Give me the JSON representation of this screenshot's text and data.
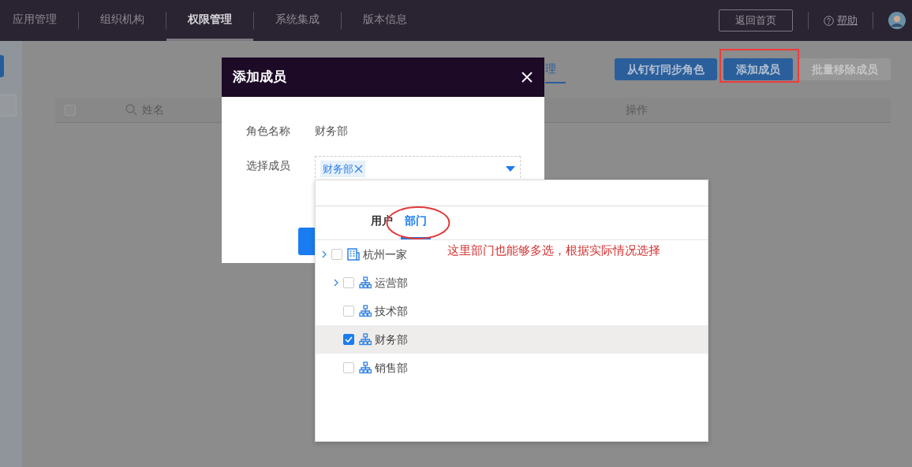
{
  "nav": {
    "tabs": [
      {
        "label": "应用管理",
        "selected": false
      },
      {
        "label": "组织机构",
        "selected": false
      },
      {
        "label": "权限管理",
        "selected": true
      },
      {
        "label": "系统集成",
        "selected": false
      },
      {
        "label": "版本信息",
        "selected": false
      }
    ],
    "home_button": "返回首页",
    "help": "帮助"
  },
  "page": {
    "tab_fragment": "理",
    "buttons": [
      {
        "label": "从钉钉同步角色",
        "disabled": false
      },
      {
        "label": "添加成员",
        "disabled": false
      },
      {
        "label": "批量移除成员",
        "disabled": true
      }
    ],
    "table": {
      "select_all_checked": false,
      "columns": [
        "姓名",
        "操作"
      ]
    }
  },
  "modal": {
    "title": "添加成员",
    "role_label": "角色名称",
    "role_value": "财务部",
    "member_label": "选择成员",
    "tags": [
      "财务部"
    ]
  },
  "dropdown": {
    "tabs": [
      {
        "label": "用户",
        "selected": false
      },
      {
        "label": "部门",
        "selected": true
      }
    ],
    "tree": [
      {
        "label": "杭州一家",
        "kind": "company",
        "expandable": true,
        "checked": false,
        "selected": false,
        "children": [
          {
            "label": "运营部",
            "kind": "department",
            "expandable": true,
            "checked": false,
            "selected": false
          },
          {
            "label": "技术部",
            "kind": "department",
            "expandable": false,
            "checked": false,
            "selected": false
          },
          {
            "label": "财务部",
            "kind": "department",
            "expandable": false,
            "checked": true,
            "selected": true
          },
          {
            "label": "销售部",
            "kind": "department",
            "expandable": false,
            "checked": false,
            "selected": false
          }
        ]
      }
    ]
  },
  "annotations": {
    "note": "这里部门也能够多选，根据实际情况选择",
    "marks": [
      {
        "kind": "ellipse"
      },
      {
        "kind": "rect"
      }
    ]
  }
}
